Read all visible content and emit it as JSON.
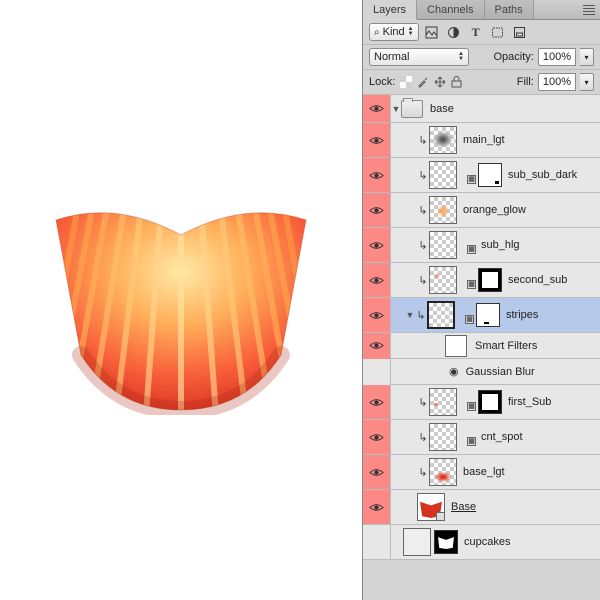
{
  "tabs": {
    "layers": "Layers",
    "channels": "Channels",
    "paths": "Paths"
  },
  "filter": {
    "kind": "Kind"
  },
  "blend": {
    "mode": "Normal",
    "opacityLabel": "Opacity:",
    "opacityValue": "100%"
  },
  "lock": {
    "label": "Lock:",
    "fillLabel": "Fill:",
    "fillValue": "100%"
  },
  "group": {
    "name": "base"
  },
  "layers": [
    {
      "name": "main_lgt"
    },
    {
      "name": "sub_sub_dark"
    },
    {
      "name": "orange_glow"
    },
    {
      "name": "sub_hlg"
    },
    {
      "name": "second_sub"
    },
    {
      "name": "stripes"
    },
    {
      "name": "first_Sub"
    },
    {
      "name": "cnt_spot"
    },
    {
      "name": "base_lgt"
    },
    {
      "name": "Base"
    },
    {
      "name": "cupcakes"
    }
  ],
  "smartFilters": {
    "label": "Smart Filters",
    "blur": "Gaussian Blur"
  },
  "chart_data": null
}
